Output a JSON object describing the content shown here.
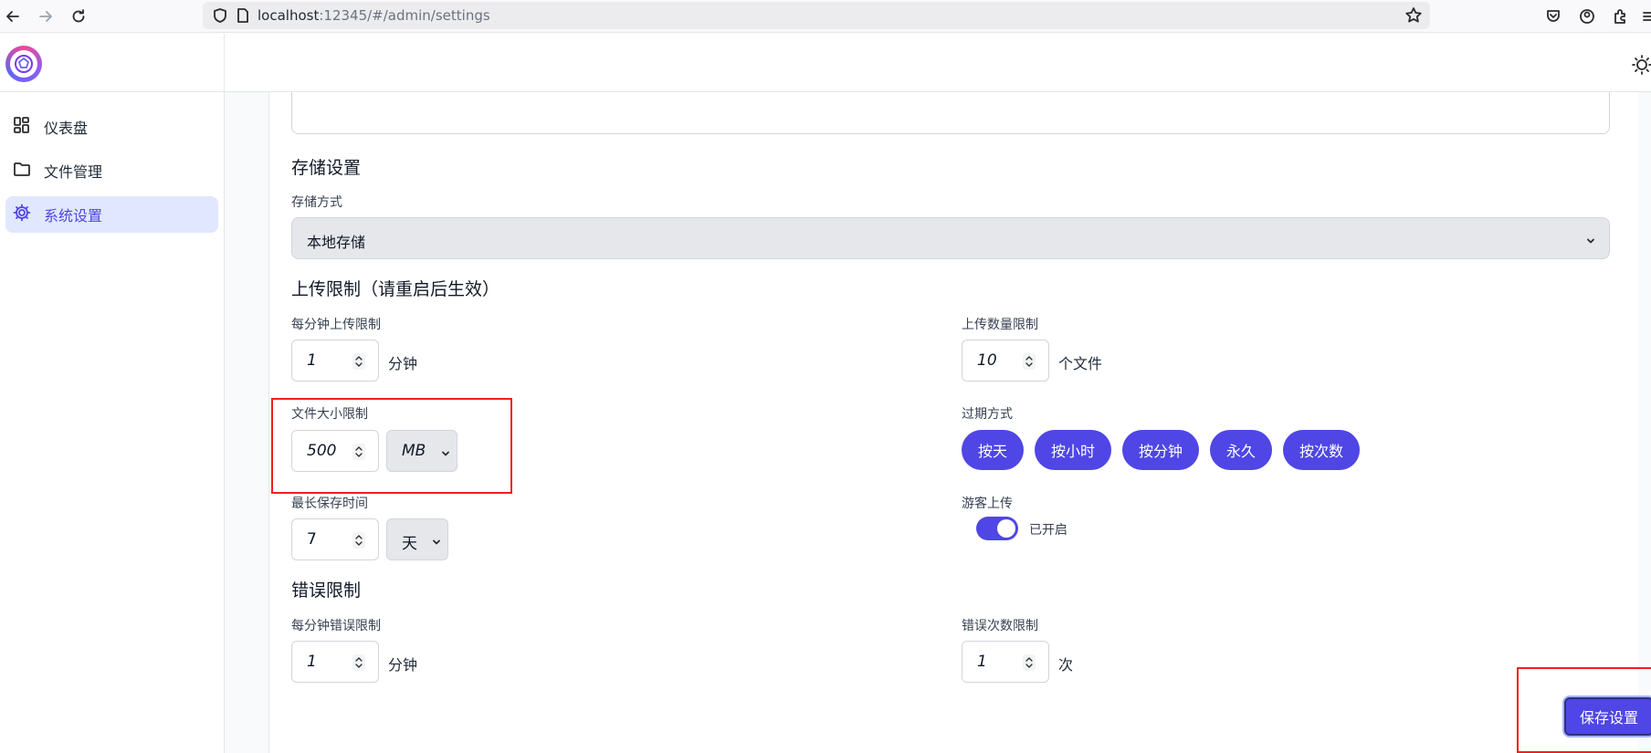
{
  "browser": {
    "url_host": "localhost",
    "url_rest": ":12345/#/admin/settings"
  },
  "sidebar": {
    "items": [
      {
        "label": "仪表盘",
        "icon": "dashboard-icon"
      },
      {
        "label": "文件管理",
        "icon": "folder-icon"
      },
      {
        "label": "系统设置",
        "icon": "gear-icon",
        "active": true
      }
    ]
  },
  "storage": {
    "section_title": "存储设置",
    "method_label": "存储方式",
    "method_value": "本地存储"
  },
  "upload": {
    "section_title": "上传限制（请重启后生效）",
    "per_minute_label": "每分钟上传限制",
    "per_minute_value": "1",
    "per_minute_unit": "分钟",
    "count_label": "上传数量限制",
    "count_value": "10",
    "count_unit": "个文件",
    "size_label": "文件大小限制",
    "size_value": "500",
    "size_unit": "MB",
    "expire_label": "过期方式",
    "expire_options": [
      "按天",
      "按小时",
      "按分钟",
      "永久",
      "按次数"
    ],
    "max_save_label": "最长保存时间",
    "max_save_value": "7",
    "max_save_unit": "天",
    "guest_label": "游客上传",
    "guest_status": "已开启",
    "guest_enabled": true
  },
  "errors": {
    "section_title": "错误限制",
    "per_minute_label": "每分钟错误限制",
    "per_minute_value": "1",
    "per_minute_unit": "分钟",
    "count_label": "错误次数限制",
    "count_value": "1",
    "count_unit": "次"
  },
  "actions": {
    "save_label": "保存设置"
  },
  "colors": {
    "accent": "#4f46e5",
    "highlight_box": "#ef1f1f"
  }
}
